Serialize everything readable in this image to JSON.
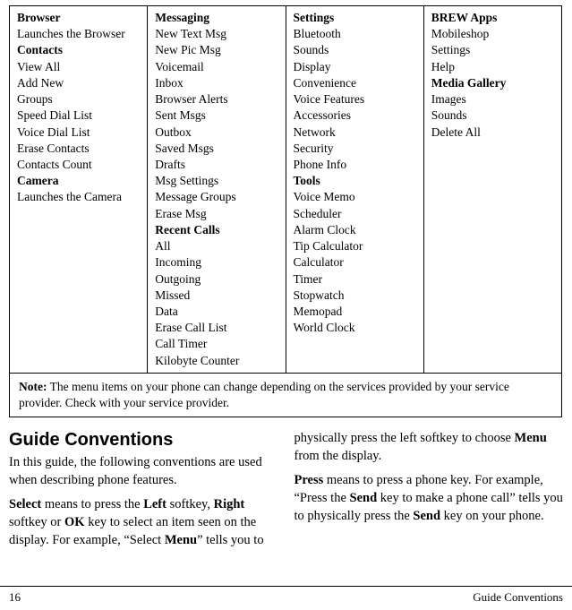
{
  "menu": {
    "col1": {
      "browser": {
        "title": "Browser",
        "items": [
          "Launches the Browser"
        ]
      },
      "contacts": {
        "title": "Contacts",
        "items": [
          "View All",
          "Add New",
          "Groups",
          "Speed Dial List",
          "Voice Dial List",
          "Erase Contacts",
          "Contacts Count"
        ]
      },
      "camera": {
        "title": "Camera",
        "items": [
          "Launches the Camera"
        ]
      }
    },
    "col2": {
      "messaging": {
        "title": "Messaging",
        "items": [
          "New Text Msg",
          "New Pic Msg",
          "Voicemail",
          "Inbox",
          "Browser Alerts",
          "Sent Msgs",
          "Outbox",
          "Saved Msgs",
          "Drafts",
          "Msg Settings",
          "Message Groups",
          "Erase Msg"
        ]
      },
      "recent": {
        "title": "Recent Calls",
        "items": [
          "All",
          "Incoming",
          "Outgoing",
          "Missed",
          "Data",
          "Erase Call List",
          "Call Timer",
          "Kilobyte Counter"
        ]
      }
    },
    "col3": {
      "settings": {
        "title": "Settings",
        "items": [
          "Bluetooth",
          "Sounds",
          "Display",
          "Convenience",
          "Voice Features",
          "Accessories",
          "Network",
          "Security",
          "Phone Info"
        ]
      },
      "tools": {
        "title": "Tools",
        "items": [
          "Voice Memo",
          "Scheduler",
          "Alarm Clock",
          "Tip Calculator",
          "Calculator",
          "Timer",
          "Stopwatch",
          "Memopad",
          "World Clock"
        ]
      }
    },
    "col4": {
      "brew": {
        "title": "BREW Apps",
        "items": [
          "Mobileshop",
          "Settings",
          "Help"
        ]
      },
      "media": {
        "title": "Media Gallery",
        "items": [
          "Images",
          "Sounds",
          "Delete All"
        ]
      }
    }
  },
  "note": {
    "label": "Note:",
    "text": " The menu items on your phone can change depending on the services provided by your service provider. Check with your service provider."
  },
  "guide": {
    "heading": "Guide Conventions",
    "p1a": "In this guide, the following conventions are used when describing phone features.",
    "p2_select": "Select",
    "p2a": " means to press the ",
    "p2_left": "Left",
    "p2b": " softkey, ",
    "p2_right": "Right",
    "p2c": " softkey or ",
    "p2_ok": "OK",
    "p2d": " key to select an item seen on the display. For example, “Select ",
    "p2_menu": "Menu",
    "p2e": "” tells you to",
    "p3a": "physically press the left softkey to choose ",
    "p3_menu": "Menu",
    "p3b": " from the display.",
    "p4_press": "Press",
    "p4a": " means to press a phone key. For example, “Press the ",
    "p4_send1": "Send",
    "p4b": " key to make a phone call” tells you to physically press the ",
    "p4_send2": "Send",
    "p4c": " key on your phone."
  },
  "footer": {
    "page": "16",
    "section": "Guide Conventions"
  }
}
